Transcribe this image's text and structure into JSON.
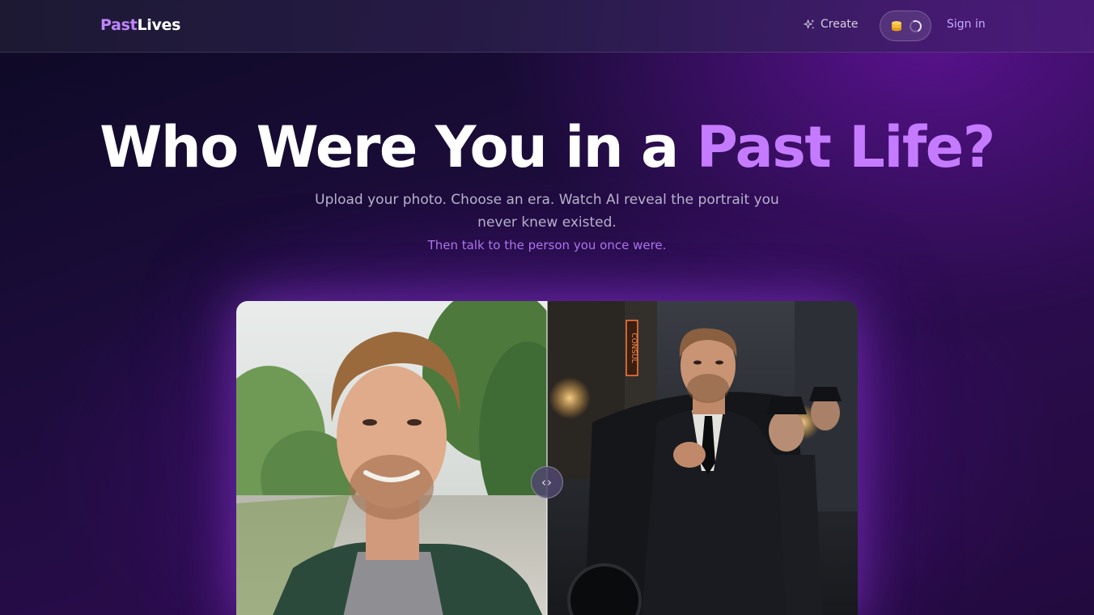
{
  "nav": {
    "logo_part1": "Past",
    "logo_part2": "Lives",
    "create_label": "Create",
    "signin_label": "Sign in",
    "credit_icon": "coin-stack-icon",
    "loading_icon": "spinner-icon"
  },
  "hero": {
    "title_plain": "Who Were You in a ",
    "title_accent": "Past Life?",
    "subtitle": "Upload your photo. Choose an era. Watch AI reveal the portrait you never knew existed.",
    "tagline": "Then talk to the person you once were."
  },
  "compare": {
    "handle_glyph": "‹›",
    "sign_text": "CONSUL"
  },
  "colors": {
    "accent": "#c57bff",
    "link": "#c9a8ff",
    "tagline": "#b07aee"
  }
}
